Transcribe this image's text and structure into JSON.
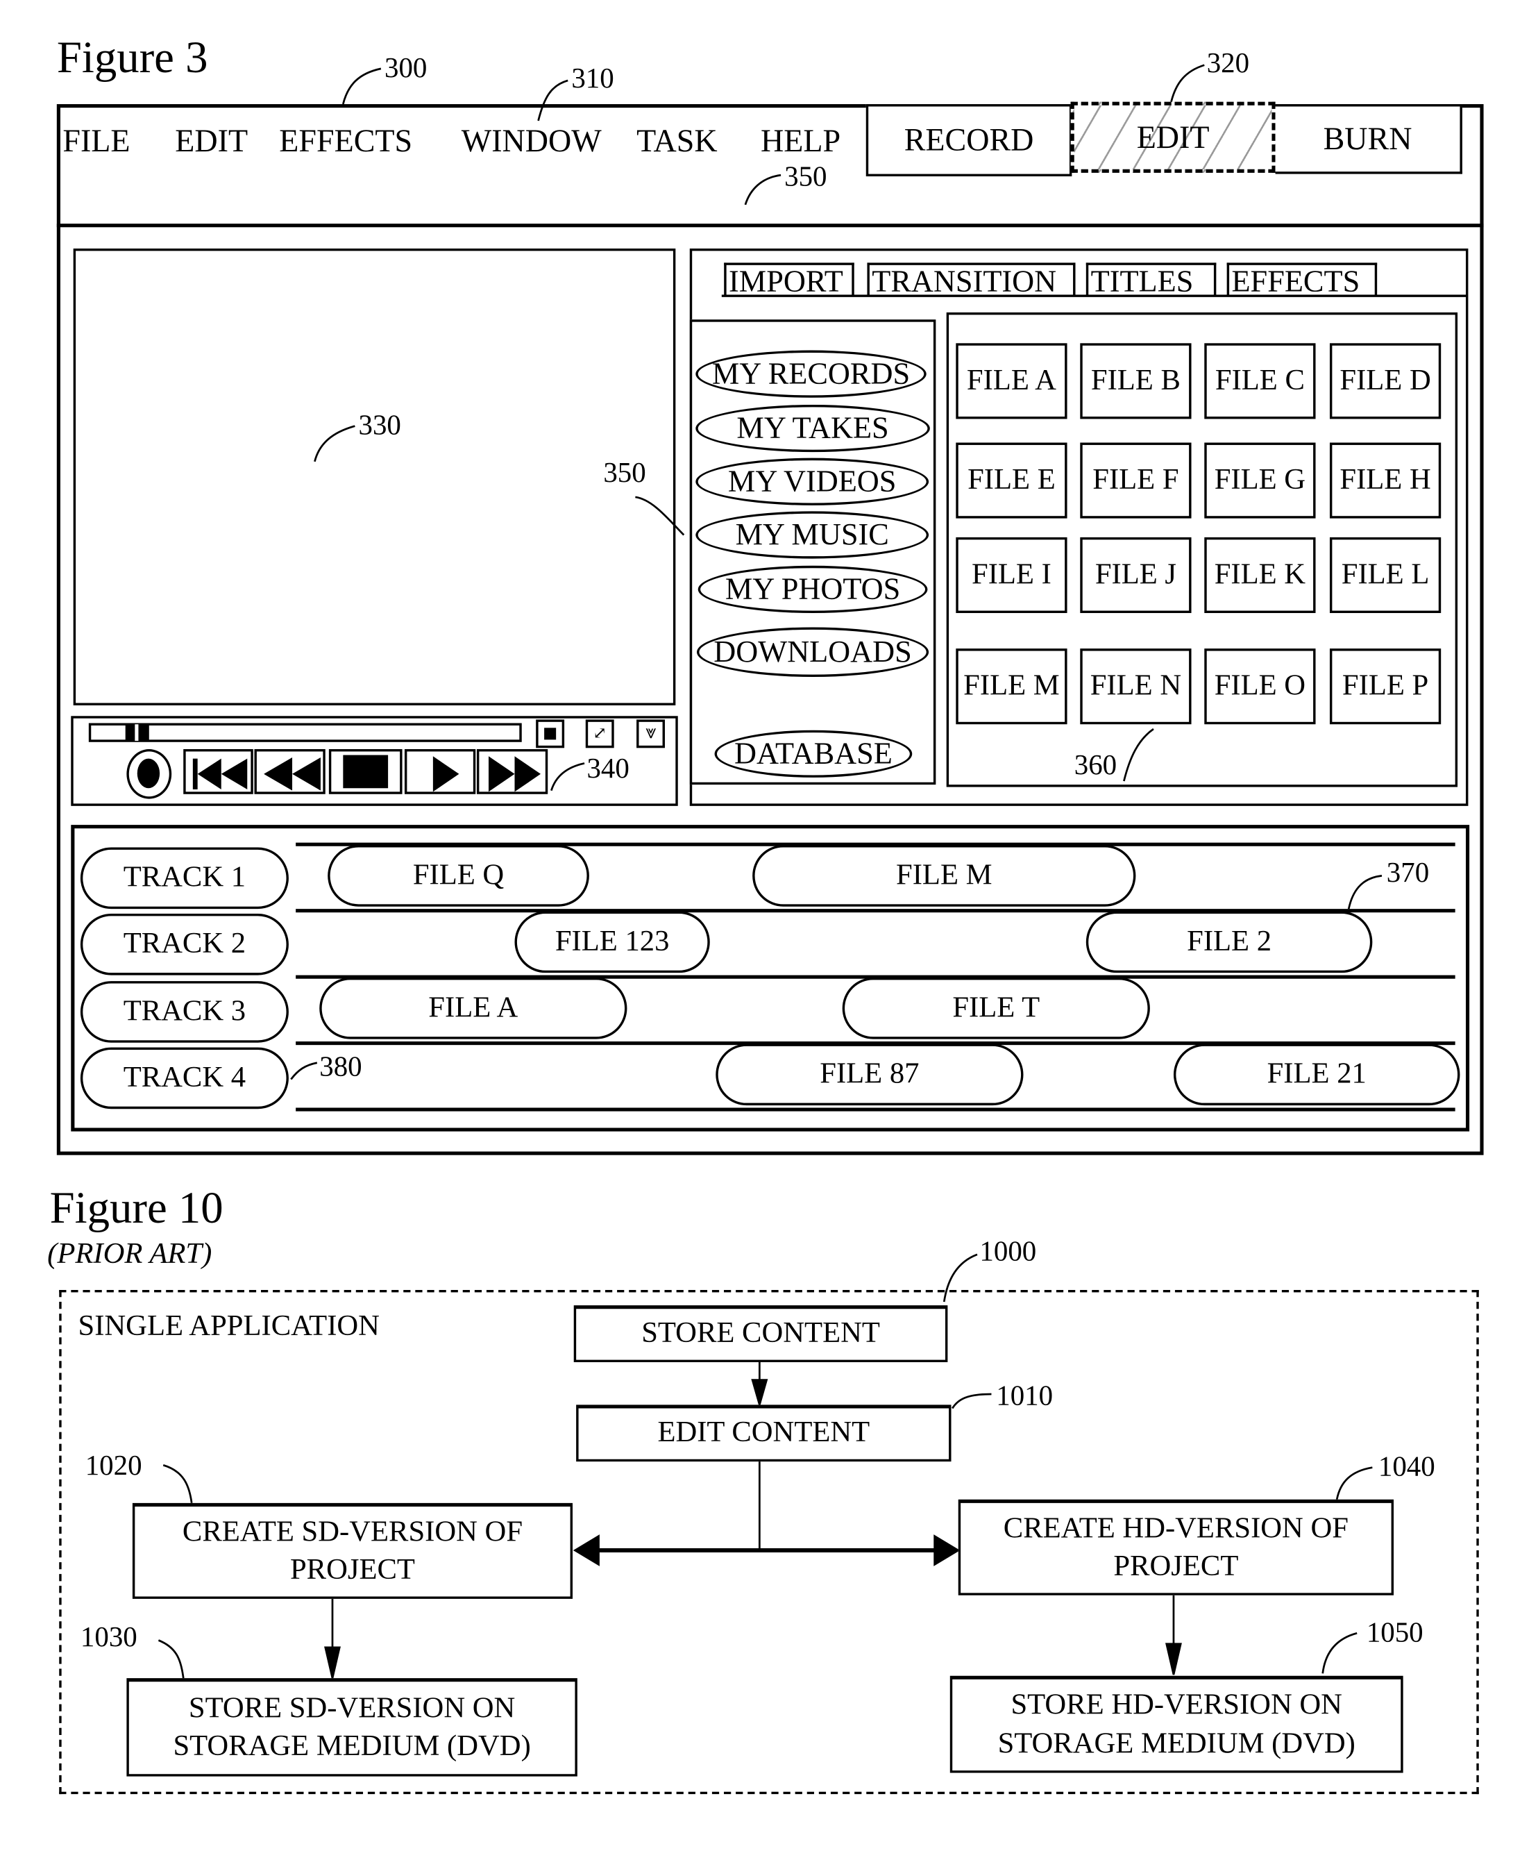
{
  "figure3": {
    "title": "Figure 3",
    "refs": {
      "window": "300",
      "menu": "310",
      "mode_edit": "320",
      "preview": "330",
      "controls": "340",
      "nav": "350",
      "nav_top": "350",
      "files": "360",
      "clip": "370",
      "track": "380"
    },
    "menu": [
      "FILE",
      "EDIT",
      "EFFECTS",
      "WINDOW",
      "TASK",
      "HELP"
    ],
    "modes": [
      {
        "label": "RECORD",
        "selected": false
      },
      {
        "label": "EDIT",
        "selected": true
      },
      {
        "label": "BURN",
        "selected": false
      }
    ],
    "player": {
      "progress": 0.08,
      "icons": [
        "stop-small-icon",
        "resize-icon",
        "dropdown-icon"
      ],
      "controls": [
        "record-icon",
        "skip-back-icon",
        "rewind-icon",
        "stop-icon",
        "play-icon",
        "fast-forward-icon"
      ]
    },
    "tabs": [
      "IMPORT",
      "TRANSITION",
      "TITLES",
      "EFFECTS"
    ],
    "nav": [
      "MY RECORDS",
      "MY TAKES",
      "MY VIDEOS",
      "MY MUSIC",
      "MY PHOTOS",
      "DOWNLOADS",
      "DATABASE"
    ],
    "files": [
      "FILE A",
      "FILE B",
      "FILE C",
      "FILE D",
      "FILE E",
      "FILE F",
      "FILE G",
      "FILE H",
      "FILE I",
      "FILE J",
      "FILE K",
      "FILE L",
      "FILE M",
      "FILE N",
      "FILE O",
      "FILE P"
    ],
    "tracks": [
      {
        "label": "TRACK 1",
        "clips": [
          "FILE Q",
          "FILE M"
        ]
      },
      {
        "label": "TRACK 2",
        "clips": [
          "FILE 123",
          "FILE 2"
        ]
      },
      {
        "label": "TRACK 3",
        "clips": [
          "FILE A",
          "FILE T"
        ]
      },
      {
        "label": "TRACK 4",
        "clips": [
          "FILE 87",
          "FILE 21"
        ]
      }
    ]
  },
  "figure10": {
    "title": "Figure 10",
    "subtitle": "(PRIOR ART)",
    "container_label": "SINGLE APPLICATION",
    "steps": {
      "store": {
        "ref": "1000",
        "text": "STORE CONTENT"
      },
      "edit": {
        "ref": "1010",
        "text": "EDIT CONTENT"
      },
      "sd_create": {
        "ref": "1020",
        "line1": "CREATE SD-VERSION OF",
        "line2": "PROJECT"
      },
      "sd_store": {
        "ref": "1030",
        "line1": "STORE SD-VERSION ON",
        "line2": "STORAGE MEDIUM (DVD)"
      },
      "hd_create": {
        "ref": "1040",
        "line1": "CREATE HD-VERSION OF",
        "line2": "PROJECT"
      },
      "hd_store": {
        "ref": "1050",
        "line1": "STORE HD-VERSION ON",
        "line2": "STORAGE MEDIUM (DVD)"
      }
    }
  }
}
